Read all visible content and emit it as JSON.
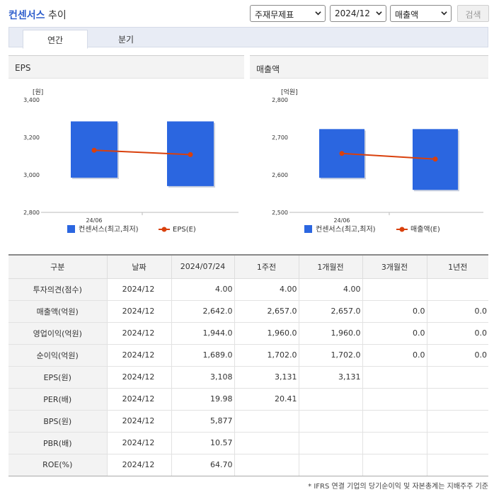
{
  "header": {
    "company": "컨센서스",
    "suffix": "추이",
    "select_type": "주재무제표",
    "select_period": "2024/12",
    "select_item": "매출액",
    "search_label": "검색"
  },
  "tabs": [
    {
      "label": "연간",
      "active": true
    },
    {
      "label": "분기",
      "active": false
    }
  ],
  "charts": {
    "eps_title": "EPS",
    "sales_title": "매출액"
  },
  "chart_data": [
    {
      "type": "bar",
      "title": "EPS",
      "ylabel": "[원]",
      "categories": [
        "24/06",
        ""
      ],
      "ylim": [
        2800,
        3400
      ],
      "yticks": [
        "2,800",
        "3,000",
        "3,200",
        "3,400"
      ],
      "series": [
        {
          "name": "컨센서스(최고,최저)",
          "kind": "range",
          "color": "#2b66e0",
          "values": [
            [
              2985,
              3285
            ],
            [
              2940,
              3285
            ]
          ]
        },
        {
          "name": "EPS(E)",
          "kind": "line",
          "color": "#d9400c",
          "values": [
            3131,
            3108
          ]
        }
      ],
      "legend": "bottom"
    },
    {
      "type": "bar",
      "title": "매출액",
      "ylabel": "[억원]",
      "categories": [
        "24/06",
        ""
      ],
      "ylim": [
        2500,
        2800
      ],
      "yticks": [
        "2,500",
        "2,600",
        "2,700",
        "2,800"
      ],
      "series": [
        {
          "name": "컨센서스(최고,최저)",
          "kind": "range",
          "color": "#2b66e0",
          "values": [
            [
              2592,
              2722
            ],
            [
              2560,
              2722
            ]
          ]
        },
        {
          "name": "매출액(E)",
          "kind": "line",
          "color": "#d9400c",
          "values": [
            2657,
            2642
          ]
        }
      ],
      "legend": "bottom"
    }
  ],
  "table": {
    "headers": [
      "구분",
      "날짜",
      "2024/07/24",
      "1주전",
      "1개월전",
      "3개월전",
      "1년전"
    ],
    "rows": [
      [
        "투자의견(점수)",
        "2024/12",
        "4.00",
        "4.00",
        "4.00",
        "",
        ""
      ],
      [
        "매출액(억원)",
        "2024/12",
        "2,642.0",
        "2,657.0",
        "2,657.0",
        "0.0",
        "0.0"
      ],
      [
        "영업이익(억원)",
        "2024/12",
        "1,944.0",
        "1,960.0",
        "1,960.0",
        "0.0",
        "0.0"
      ],
      [
        "순이익(억원)",
        "2024/12",
        "1,689.0",
        "1,702.0",
        "1,702.0",
        "0.0",
        "0.0"
      ],
      [
        "EPS(원)",
        "2024/12",
        "3,108",
        "3,131",
        "3,131",
        "",
        ""
      ],
      [
        "PER(배)",
        "2024/12",
        "19.98",
        "20.41",
        "",
        "",
        ""
      ],
      [
        "BPS(원)",
        "2024/12",
        "5,877",
        "",
        "",
        "",
        ""
      ],
      [
        "PBR(배)",
        "2024/12",
        "10.57",
        "",
        "",
        "",
        ""
      ],
      [
        "ROE(%)",
        "2024/12",
        "64.70",
        "",
        "",
        "",
        ""
      ]
    ]
  },
  "footnote": "* IFRS 연결 기업의 당기순이익 및 자본총계는 지배주주 기준"
}
